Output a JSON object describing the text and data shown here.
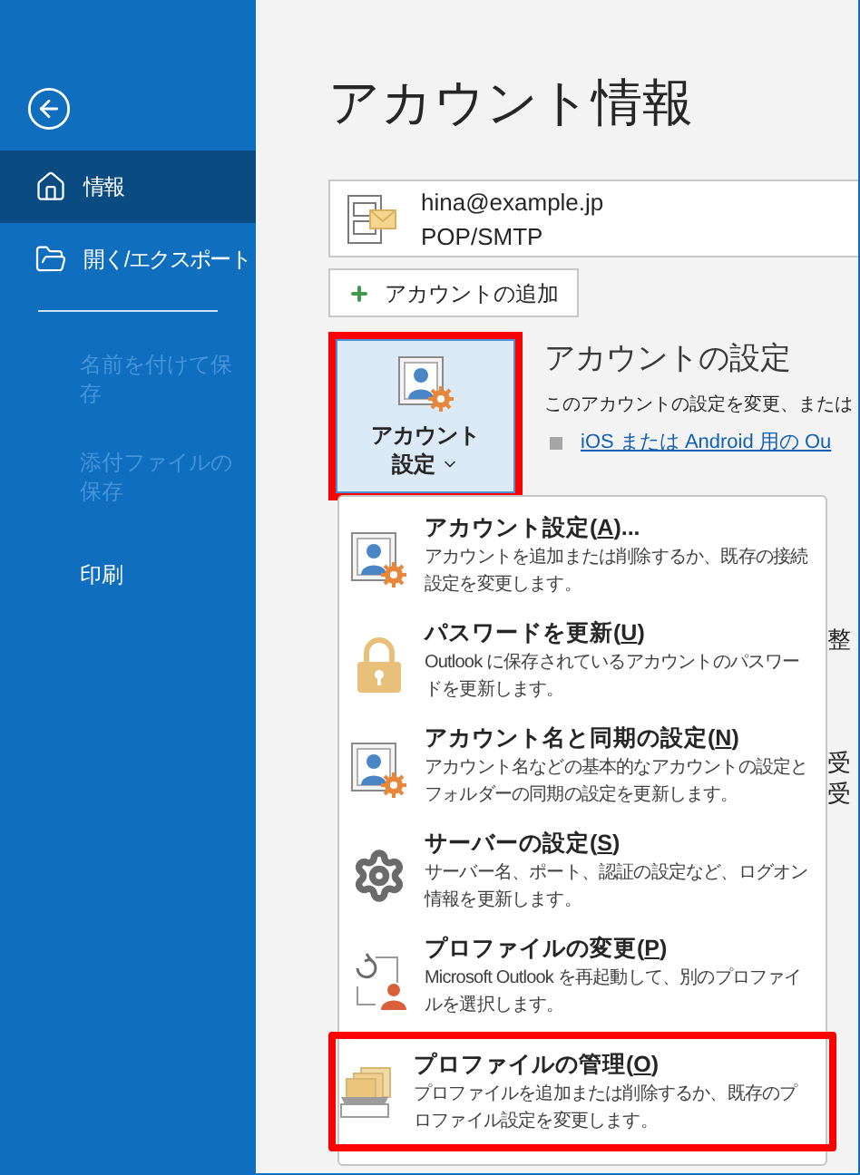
{
  "sidebar": {
    "primary": [
      {
        "label": "情報",
        "selected": true
      },
      {
        "label": "開く/エクスポート",
        "selected": false
      }
    ],
    "secondary": [
      {
        "label": "名前を付けて保存",
        "disabled": true
      },
      {
        "label": "添付ファイルの保存",
        "disabled": true
      },
      {
        "label": "印刷",
        "disabled": false
      }
    ]
  },
  "title": "アカウント情報",
  "account": {
    "email": "hina@example.jp",
    "type": "POP/SMTP"
  },
  "add_account_button": "アカウントの追加",
  "account_settings_button": {
    "label_line1": "アカウント",
    "label_line2": "設定",
    "highlighted": true
  },
  "account_settings_section": {
    "heading": "アカウントの設定",
    "description": "このアカウントの設定を変更、または",
    "link": "iOS または Android 用の Ou"
  },
  "background_text": [
    "整",
    "受",
    "受"
  ],
  "menu": [
    {
      "kind": "account",
      "title_before": "アカウント設定(",
      "access_key": "A",
      "title_after": ")...",
      "description": "アカウントを追加または削除するか、既存の接続設定を変更します。",
      "highlighted": false
    },
    {
      "kind": "lock",
      "title_before": "パスワードを更新(",
      "access_key": "U",
      "title_after": ")",
      "description": "Outlook に保存されているアカウントのパスワードを更新します。",
      "highlighted": false
    },
    {
      "kind": "account",
      "title_before": "アカウント名と同期の設定(",
      "access_key": "N",
      "title_after": ")",
      "description": "アカウント名などの基本的なアカウントの設定とフォルダーの同期の設定を更新します。",
      "highlighted": false
    },
    {
      "kind": "gear",
      "title_before": "サーバーの設定(",
      "access_key": "S",
      "title_after": ")",
      "description": "サーバー名、ポート、認証の設定など、ログオン情報を更新します。",
      "highlighted": false
    },
    {
      "kind": "profile-change",
      "title_before": "プロファイルの変更(",
      "access_key": "P",
      "title_after": ")",
      "description": "Microsoft Outlook を再起動して、別のプロファイルを選択します。",
      "highlighted": false
    },
    {
      "kind": "profile-folder",
      "title_before": "プロファイルの管理(",
      "access_key": "O",
      "title_after": ")",
      "description": "プロファイルを追加または削除するか、既存のプロファイル設定を変更します。",
      "highlighted": true
    }
  ]
}
